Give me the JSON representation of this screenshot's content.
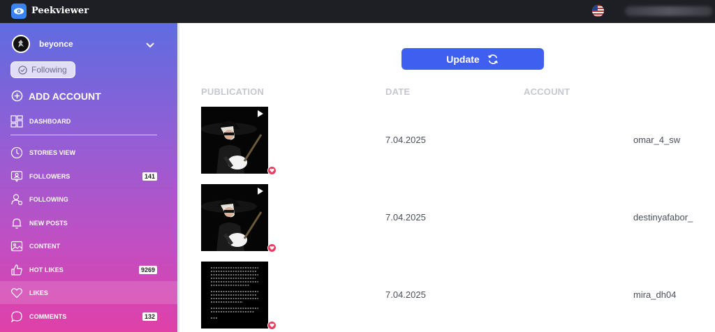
{
  "app": {
    "brand": "Peekviewer"
  },
  "sidebar": {
    "account_name": "beyonce",
    "following_label": "Following",
    "add_account_label": "ADD ACCOUNT",
    "dashboard_label": "DASHBOARD",
    "items": [
      {
        "label": "STORIES VIEW",
        "badge": ""
      },
      {
        "label": "FOLLOWERS",
        "badge": "141"
      },
      {
        "label": "FOLLOWING",
        "badge": ""
      },
      {
        "label": "NEW POSTS",
        "badge": ""
      },
      {
        "label": "CONTENT",
        "badge": ""
      },
      {
        "label": "HOT LIKES",
        "badge": "9269"
      },
      {
        "label": "LIKES",
        "badge": ""
      },
      {
        "label": "COMMENTS",
        "badge": "132"
      }
    ]
  },
  "main": {
    "update_label": "Update",
    "columns": [
      "PUBLICATION",
      "DATE",
      "ACCOUNT"
    ],
    "rows": [
      {
        "date": "7.04.2025",
        "account": "omar_4_sw",
        "thumb": "video"
      },
      {
        "date": "7.04.2025",
        "account": "destinyafabor_",
        "thumb": "video"
      },
      {
        "date": "7.04.2025",
        "account": "mira_dh04",
        "thumb": "text"
      }
    ]
  },
  "colors": {
    "topbar": "#1e1f25",
    "accent": "#3f5ff0",
    "heart": "#f03a5f"
  }
}
